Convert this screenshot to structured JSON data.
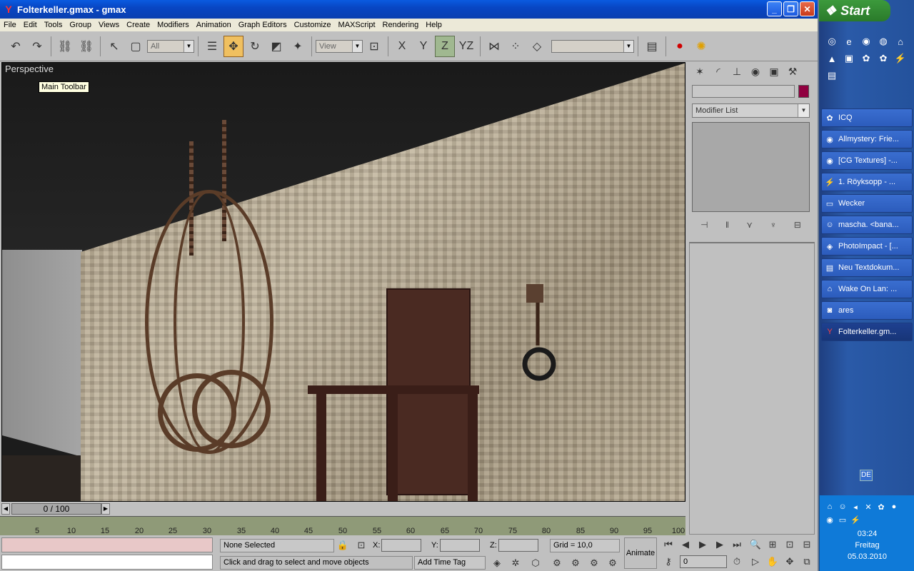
{
  "window": {
    "title": "Folterkeller.gmax - gmax"
  },
  "menu": [
    "File",
    "Edit",
    "Tools",
    "Group",
    "Views",
    "Create",
    "Modifiers",
    "Animation",
    "Graph Editors",
    "Customize",
    "MAXScript",
    "Rendering",
    "Help"
  ],
  "toolbar": {
    "selection_filter": "All",
    "coord_system": "View",
    "named_selection": ""
  },
  "viewport": {
    "label": "Perspective",
    "tooltip": "Main Toolbar"
  },
  "timeslider": {
    "value": "0 / 100"
  },
  "track": {
    "ticks": [
      "5",
      "10",
      "15",
      "20",
      "25",
      "30",
      "35",
      "40",
      "45",
      "50",
      "55",
      "60",
      "65",
      "70",
      "75",
      "80",
      "85",
      "90",
      "95",
      "100"
    ]
  },
  "status": {
    "selection": "None Selected",
    "prompt": "Click and drag to select and move objects",
    "x_label": "X:",
    "y_label": "Y:",
    "z_label": "Z:",
    "grid": "Grid = 10,0",
    "add_time_tag": "Add Time Tag",
    "animate": "Animate",
    "frame": "0"
  },
  "command_panel": {
    "modifier_list": "Modifier List"
  },
  "taskbar": {
    "start": "Start",
    "items": [
      {
        "label": "ICQ",
        "icon": "flower-icon"
      },
      {
        "label": "Allmystery: Frie...",
        "icon": "firefox-icon"
      },
      {
        "label": "[CG Textures] -...",
        "icon": "firefox-icon"
      },
      {
        "label": "1. Röyksopp - ...",
        "icon": "winamp-icon"
      },
      {
        "label": "Wecker",
        "icon": "window-icon"
      },
      {
        "label": "mascha. <bana...",
        "icon": "messenger-icon"
      },
      {
        "label": "PhotoImpact - [...",
        "icon": "photoimpact-icon"
      },
      {
        "label": "Neu Textdokum...",
        "icon": "notepad-icon"
      },
      {
        "label": "Wake On Lan: ...",
        "icon": "network-icon"
      },
      {
        "label": "ares",
        "icon": "ares-icon"
      },
      {
        "label": "Folterkeller.gm...",
        "icon": "gmax-icon"
      }
    ],
    "lang": "DE",
    "time": "03:24",
    "day": "Freitag",
    "date": "05.03.2010"
  }
}
